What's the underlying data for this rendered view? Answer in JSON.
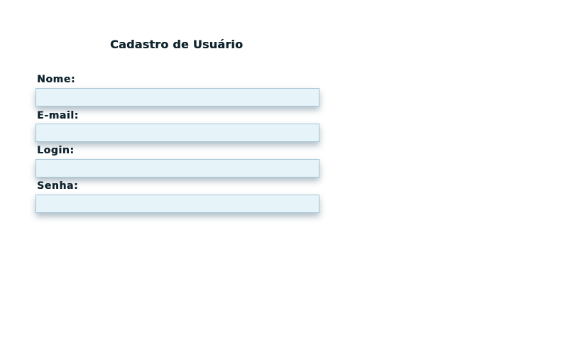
{
  "form": {
    "title": "Cadastro de Usuário",
    "fields": [
      {
        "label": "Nome:",
        "value": "",
        "type": "text"
      },
      {
        "label": "E-mail:",
        "value": "",
        "type": "text"
      },
      {
        "label": "Login:",
        "value": "",
        "type": "text"
      },
      {
        "label": "Senha:",
        "value": "",
        "type": "password"
      }
    ]
  }
}
